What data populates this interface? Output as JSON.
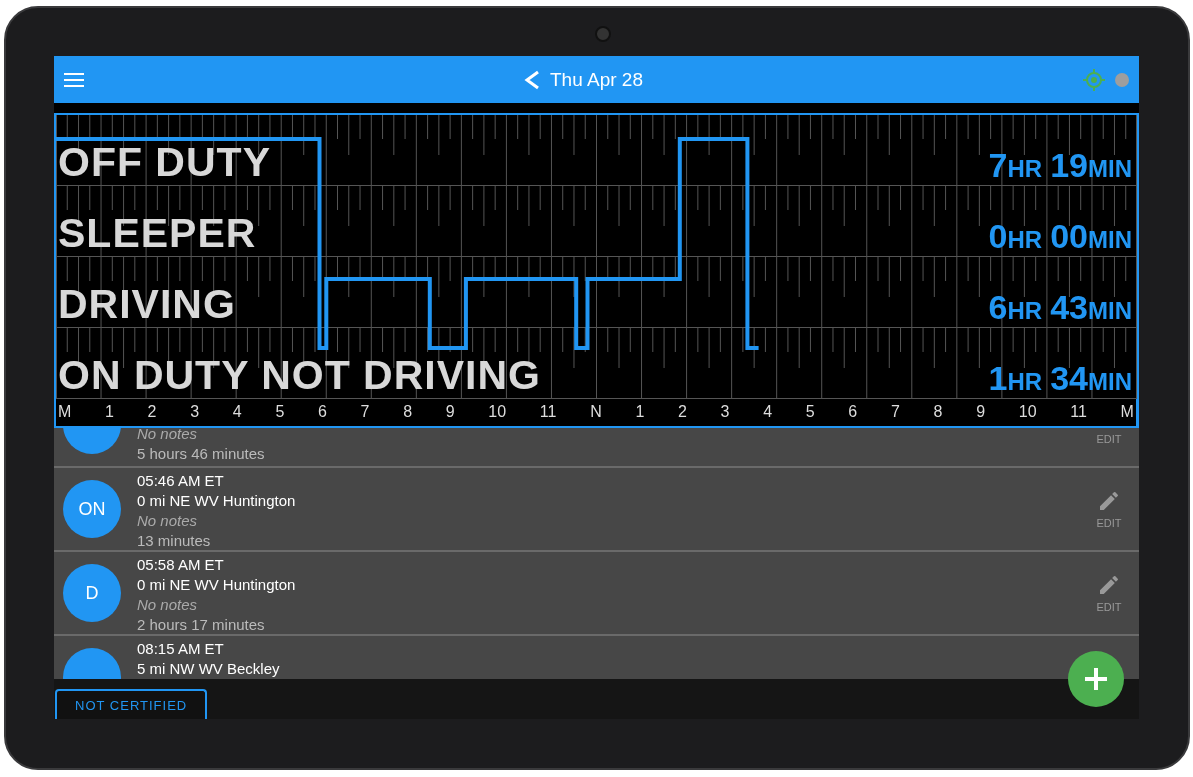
{
  "header": {
    "title": "Thu Apr 28"
  },
  "chart": {
    "statuses": [
      {
        "label": "OFF DUTY",
        "hours": "7",
        "hours_unit": "HR",
        "minutes": "19",
        "minutes_unit": "MIN"
      },
      {
        "label": "SLEEPER",
        "hours": "0",
        "hours_unit": "HR",
        "minutes": "00",
        "minutes_unit": "MIN"
      },
      {
        "label": "DRIVING",
        "hours": "6",
        "hours_unit": "HR",
        "minutes": "43",
        "minutes_unit": "MIN"
      },
      {
        "label": "ON DUTY NOT DRIVING",
        "hours": "1",
        "hours_unit": "HR",
        "minutes": "34",
        "minutes_unit": "MIN"
      }
    ],
    "hour_labels": [
      "M",
      "1",
      "2",
      "3",
      "4",
      "5",
      "6",
      "7",
      "8",
      "9",
      "10",
      "11",
      "N",
      "1",
      "2",
      "3",
      "4",
      "5",
      "6",
      "7",
      "8",
      "9",
      "10",
      "11",
      "M"
    ]
  },
  "events": [
    {
      "notes": "No notes",
      "duration": "5 hours 46 minutes",
      "edit_label": "EDIT"
    },
    {
      "status": "ON",
      "time": "05:46 AM ET",
      "location": "0 mi NE WV Huntington",
      "notes": "No notes",
      "duration": "13 minutes",
      "edit_label": "EDIT"
    },
    {
      "status": "D",
      "time": "05:58 AM ET",
      "location": "0 mi NE WV Huntington",
      "notes": "No notes",
      "duration": "2 hours 17 minutes",
      "edit_label": "EDIT"
    },
    {
      "time": "08:15 AM ET",
      "location": "5 mi NW WV Beckley"
    }
  ],
  "footer": {
    "certify_button": "NOT CERTIFIED"
  }
}
